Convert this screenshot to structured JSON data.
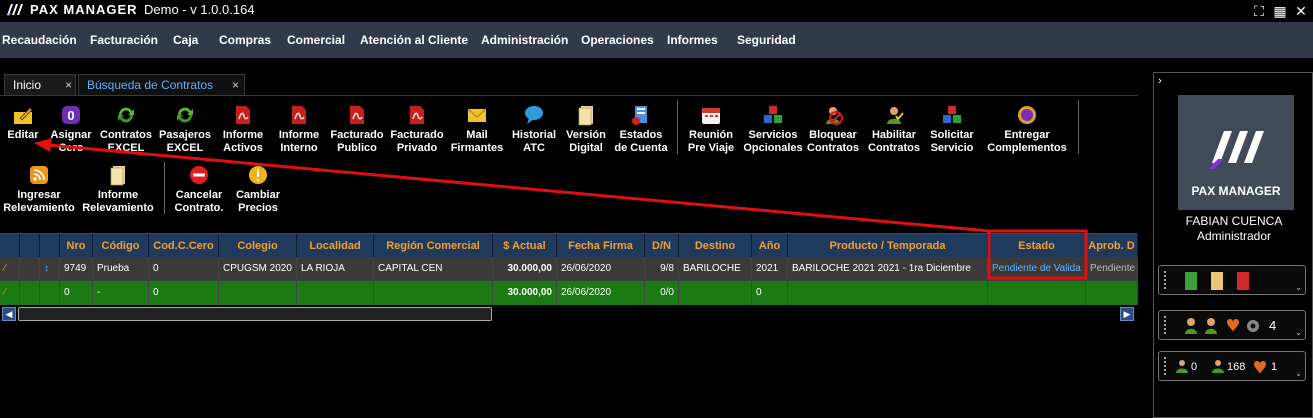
{
  "app": {
    "brand": "PAX MANAGER",
    "version": "Demo - v 1.0.0.164"
  },
  "window_controls": {
    "restore": "⛶",
    "grid": "▦",
    "close": "✕"
  },
  "menu": [
    "Recaudación",
    "Facturación",
    "Caja",
    "Compras",
    "Comercial",
    "Atención al Cliente",
    "Administración",
    "Operaciones",
    "Informes",
    "Seguridad"
  ],
  "tabs": [
    {
      "label": "Inicio",
      "close": "×"
    },
    {
      "label": "Búsqueda de Contratos",
      "close": "×"
    }
  ],
  "toolbar_row1": [
    {
      "line1": "Editar",
      "line2": "",
      "icon": "pencil-folder-icon"
    },
    {
      "line1": "Asignar",
      "line2": "Cero",
      "icon": "zero-badge-icon"
    },
    {
      "line1": "Contratos",
      "line2": "EXCEL",
      "icon": "refresh-green-icon"
    },
    {
      "line1": "Pasajeros",
      "line2": "EXCEL",
      "icon": "refresh-green-icon"
    },
    {
      "line1": "Informe",
      "line2": "Activos",
      "icon": "pdf-icon"
    },
    {
      "line1": "Informe",
      "line2": "Interno",
      "icon": "pdf-icon"
    },
    {
      "line1": "Facturado",
      "line2": "Publico",
      "icon": "pdf-icon"
    },
    {
      "line1": "Facturado",
      "line2": "Privado",
      "icon": "pdf-icon"
    },
    {
      "line1": "Mail",
      "line2": "Firmantes",
      "icon": "mail-icon"
    },
    {
      "line1": "Historial",
      "line2": "ATC",
      "icon": "chat-bubble-icon"
    },
    {
      "line1": "Versión",
      "line2": "Digital",
      "icon": "document-icon"
    },
    {
      "line1": "Estados",
      "line2": "de Cuenta",
      "icon": "account-state-icon"
    },
    {
      "line1": "Reunión",
      "line2": "Pre Viaje",
      "icon": "calendar-icon"
    },
    {
      "line1": "Servicios",
      "line2": "Opcionales",
      "icon": "cubes-icon"
    },
    {
      "line1": "Bloquear",
      "line2": "Contratos",
      "icon": "block-user-icon"
    },
    {
      "line1": "Habilitar",
      "line2": "Contratos",
      "icon": "enable-user-icon"
    },
    {
      "line1": "Solicitar",
      "line2": "Servicio",
      "icon": "cubes-icon"
    },
    {
      "line1": "Entregar",
      "line2": "Complementos",
      "icon": "purple-badge-icon"
    }
  ],
  "toolbar_row2": [
    {
      "line1": "Ingresar",
      "line2": "Relevamiento",
      "icon": "rss-icon"
    },
    {
      "line1": "Informe",
      "line2": "Relevamiento",
      "icon": "document-icon"
    },
    {
      "line1": "Cancelar",
      "line2": "Contrato.",
      "icon": "cancel-icon"
    },
    {
      "line1": "Cambiar",
      "line2": "Precios",
      "icon": "warning-icon"
    }
  ],
  "grid": {
    "headers": [
      "",
      "",
      "",
      "Nro",
      "Código",
      "Cod.C.Cero",
      "Colegio",
      "Localidad",
      "Región Comercial",
      "$ Actual",
      "Fecha Firma",
      "D/N",
      "Destino",
      "Año",
      "Producto / Temporada",
      "Estado",
      "Aprob. D"
    ],
    "rows": [
      [
        "",
        "",
        "",
        "9749",
        "Prueba",
        "0",
        "CPUGSM 2020",
        "LA RIOJA",
        "CAPITAL CEN",
        "30.000,00",
        "26/06/2020",
        "9/8",
        "BARILOCHE",
        "2021",
        "BARILOCHE 2021 2021 - 1ra Diciembre",
        "Pendiente de Valida",
        "Pendiente"
      ],
      [
        "",
        "",
        "",
        "0",
        "-",
        "0",
        "",
        "",
        "",
        "30.000,00",
        "26/06/2020",
        "0/0",
        "",
        "0",
        "",
        "",
        ""
      ]
    ]
  },
  "sidebar": {
    "user_name": "FABIAN CUENCA",
    "user_role": "Administrador",
    "counter_a": "4",
    "counter_b1": "0",
    "counter_b2": "168",
    "counter_b3": "1"
  },
  "colors": {
    "menubar": "#303a4a",
    "grid_header": "#203a5e",
    "header_text": "#f0a030",
    "row_green": "#1c7a14",
    "highlight": "#e01010",
    "estado_text": "#5fb0ff"
  }
}
